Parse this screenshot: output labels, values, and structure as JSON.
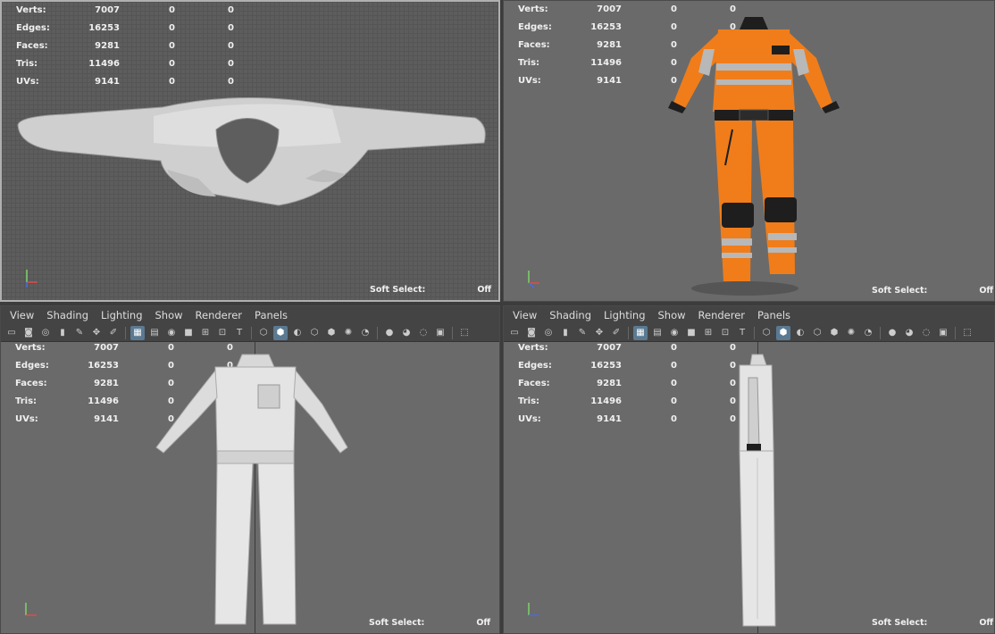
{
  "hud": {
    "labels": {
      "verts": "Verts:",
      "edges": "Edges:",
      "faces": "Faces:",
      "tris": "Tris:",
      "uvs": "UVs:"
    },
    "values": {
      "verts": "7007",
      "edges": "16253",
      "faces": "9281",
      "tris": "11496",
      "uvs": "9141"
    },
    "zero": "0"
  },
  "soft_select": {
    "label": "Soft Select:",
    "value": "Off"
  },
  "menu": {
    "view": "View",
    "shading": "Shading",
    "lighting": "Lighting",
    "show": "Show",
    "renderer": "Renderer",
    "panels": "Panels"
  },
  "colors": {
    "orange": "#f07d1a",
    "reflective": "#b8b8b8",
    "black": "#1e1e1e",
    "toolbar_active": "#5b7a92"
  },
  "icons": [
    "camera-icon",
    "lock-camera-icon",
    "bookmark-icon",
    "pencil-icon",
    "grid-icon",
    "film-gate-icon",
    "resolution-gate-icon",
    "wireframe-icon",
    "smooth-shade-icon",
    "texture-icon",
    "light-icon",
    "isolate-icon",
    "xray-icon"
  ]
}
